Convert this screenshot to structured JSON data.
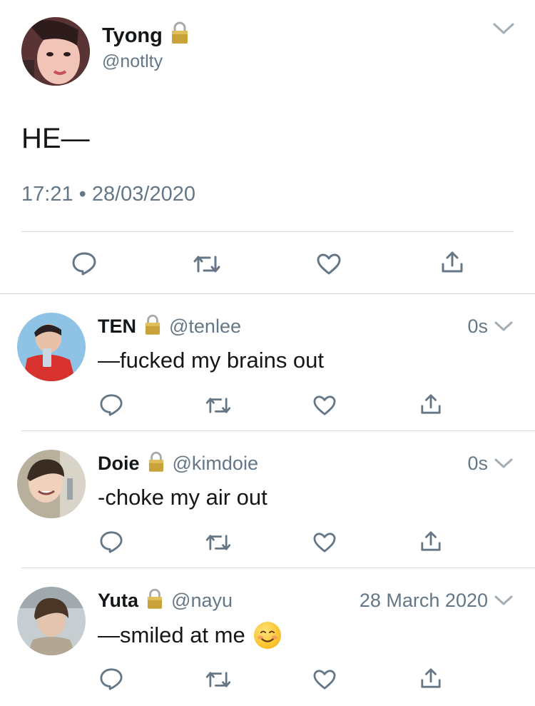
{
  "main_tweet": {
    "name": "Tyong",
    "handle": "@notlty",
    "text": "HE—",
    "meta": "17:21 • 28/03/2020",
    "avatar_icon": "avatar-photo",
    "locked": true
  },
  "replies": [
    {
      "name": "TEN",
      "handle": "@tenlee",
      "time": "0s",
      "text": "—fucked my brains out",
      "locked": true
    },
    {
      "name": "Doie",
      "handle": "@kimdoie",
      "time": "0s",
      "text": "-choke my air out",
      "locked": true
    },
    {
      "name": "Yuta",
      "handle": "@nayu",
      "time": "28 March 2020",
      "text": "—smiled at me",
      "emoji": "smiling-face-emoji",
      "locked": true
    }
  ],
  "icons": {
    "reply": "reply-icon",
    "retweet": "retweet-icon",
    "like": "heart-icon",
    "share": "share-icon",
    "lock": "lock-icon",
    "more": "chevron-down-icon"
  },
  "colors": {
    "text": "#14171a",
    "secondary": "#657786",
    "divider": "#d8dde1",
    "action_icon": "#657786"
  }
}
